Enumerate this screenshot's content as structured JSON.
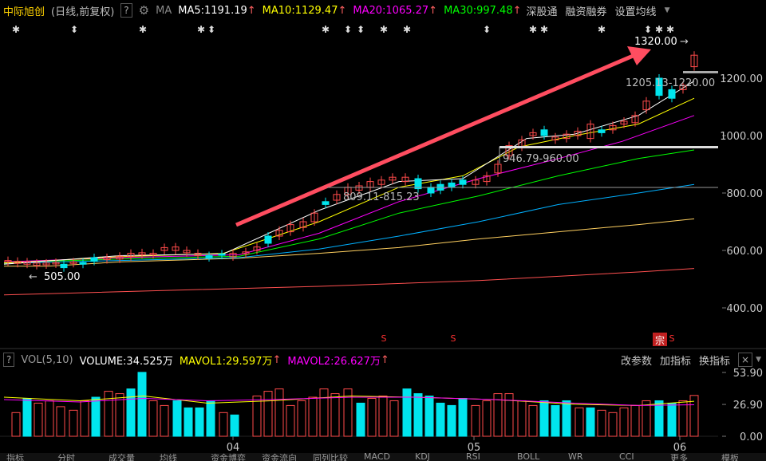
{
  "header": {
    "stock_name": "中际旭创",
    "period": "(日线,前复权)",
    "help": "?",
    "ma_label": "MA",
    "ma5": "MA5:1191.19",
    "ma10": "MA10:1129.47",
    "ma20": "MA20:1065.27",
    "ma30": "MA30:997.48",
    "right_buttons": [
      "深股通",
      "融资融券",
      "设置均线"
    ],
    "arrow_up": "↑"
  },
  "price_axis": [
    "1200.00",
    "1000.00",
    "800.00",
    "600.00",
    "400.00"
  ],
  "annotations": {
    "high": "1320.00",
    "low": "505.00",
    "range1": "809.11-815.23",
    "range2": "946.79-960.00",
    "range3": "1205.13-1220.00",
    "right_arrow": "→",
    "left_arrow": "←"
  },
  "volume": {
    "label": "VOL(5,10)",
    "volume": "VOLUME:34.525万",
    "mavol1": "MAVOL1:29.597万",
    "mavol2": "MAVOL2:26.627万",
    "arrow_up": "↑",
    "buttons": [
      "改参数",
      "加指标",
      "换指标"
    ],
    "axis": [
      "53.90",
      "26.90",
      "0.00"
    ]
  },
  "x_axis": [
    "04",
    "05",
    "06"
  ],
  "bottom_tabs": [
    "指标",
    "分时",
    "成交量",
    "均线",
    "资金博弈",
    "资金流向",
    "同列比较",
    "MACD",
    "KDJ",
    "RSI",
    "BOLL",
    "WR",
    "CCI",
    "更多",
    "模板"
  ],
  "markers": {
    "s": "S",
    "zong": "宗",
    "star": "✱",
    "dbl": "⬍"
  },
  "colors": {
    "up": "#ff4a4a",
    "down": "#00e5ee",
    "ma5": "#ffffff",
    "ma10": "#ffff00",
    "ma20": "#ff00ff",
    "ma30": "#00ff00",
    "ma60": "#00b0ff",
    "ma120": "#ffd060",
    "ma250": "#ff5050",
    "arrow": "#ff4d60"
  }
}
